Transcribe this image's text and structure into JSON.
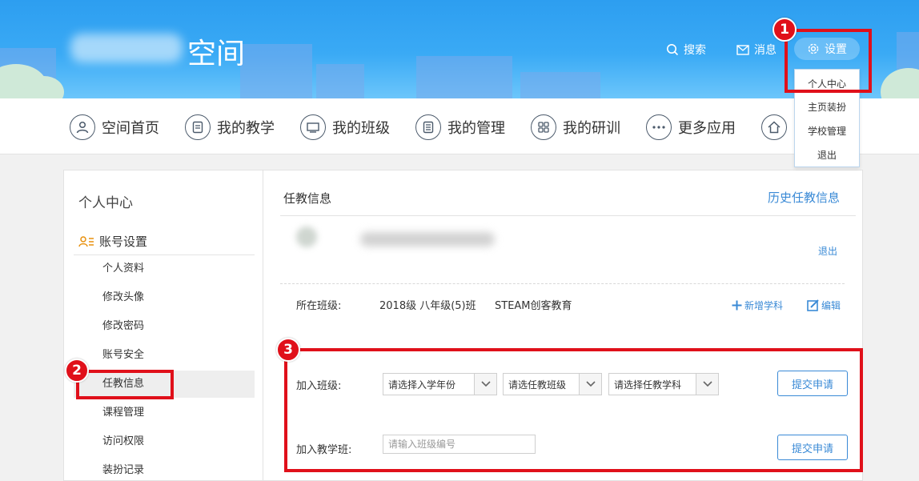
{
  "header": {
    "site_title": "空间",
    "search_label": "搜索",
    "messages_label": "消息",
    "settings_label": "设置"
  },
  "dropdown": {
    "items": [
      "个人中心",
      "主页装扮",
      "学校管理",
      "退出"
    ]
  },
  "nav": {
    "items": [
      {
        "label": "空间首页",
        "icon": "user-icon"
      },
      {
        "label": "我的教学",
        "icon": "document-icon"
      },
      {
        "label": "我的班级",
        "icon": "monitor-icon"
      },
      {
        "label": "我的管理",
        "icon": "list-icon"
      },
      {
        "label": "我的研训",
        "icon": "grid-icon"
      },
      {
        "label": "更多应用",
        "icon": "more-icon"
      },
      {
        "label": "",
        "icon": "home-icon"
      }
    ]
  },
  "sidebar": {
    "title": "个人中心",
    "group_label": "账号设置",
    "items": [
      "个人资料",
      "修改头像",
      "修改密码",
      "账号安全",
      "任教信息",
      "课程管理",
      "访问权限",
      "装扮记录"
    ],
    "active_index": 4
  },
  "content": {
    "title": "任教信息",
    "history_link": "历史任教信息",
    "logout_link": "退出",
    "class_label": "所在班级:",
    "class_value": "2018级 八年级(5)班",
    "class_subject": "STEAM创客教育",
    "add_subject": "新增学科",
    "edit": "编辑",
    "join_class_label": "加入班级:",
    "select_year_placeholder": "请选择入学年份",
    "select_class_placeholder": "请选任教班级",
    "select_subject_placeholder": "请选择任教学科",
    "submit_label": "提交申请",
    "join_teaching_label": "加入教学班:",
    "class_code_placeholder": "请输入班级编号"
  },
  "annotations": {
    "badge_1": "1",
    "badge_2": "2",
    "badge_3": "3",
    "color": "#e0101a"
  },
  "colors": {
    "banner": "#2d9ef0",
    "link": "#3a8ad6"
  }
}
